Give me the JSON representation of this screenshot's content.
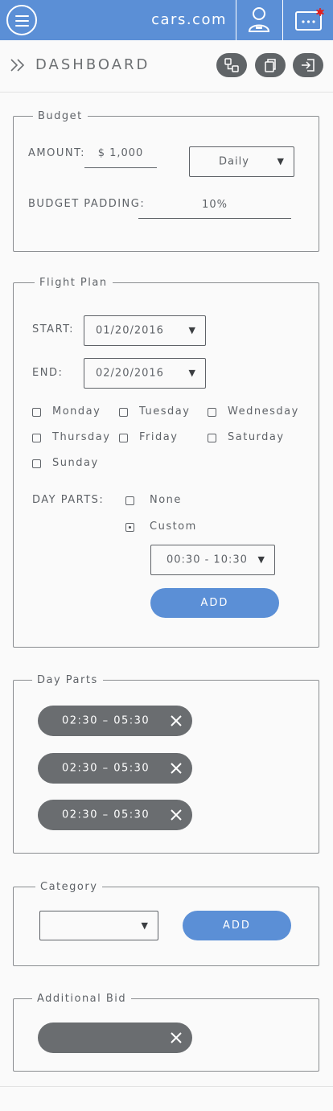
{
  "topbar": {
    "brand": "cars.com",
    "notification_color": "#e02020"
  },
  "header": {
    "title": "DASHBOARD"
  },
  "budget": {
    "legend": "Budget",
    "amount_label": "AMOUNT:",
    "amount_value": "$ 1,000",
    "period": "Daily",
    "padding_label": "BUDGET PADDING:",
    "padding_value": "10%"
  },
  "flight": {
    "legend": "Flight Plan",
    "start_label": "START:",
    "start_value": "01/20/2016",
    "end_label": "END:",
    "end_value": "02/20/2016",
    "days": [
      "Monday",
      "Tuesday",
      "Wednesday",
      "Thursday",
      "Friday",
      "Saturday",
      "Sunday"
    ],
    "day_parts_label": "DAY PARTS:",
    "none_label": "None",
    "custom_label": "Custom",
    "custom_selected": true,
    "time_range": "00:30 - 10:30",
    "add_label": "ADD"
  },
  "day_parts": {
    "legend": "Day Parts",
    "items": [
      "02:30  –  05:30",
      "02:30  –  05:30",
      "02:30  –  05:30"
    ]
  },
  "category": {
    "legend": "Category",
    "selected": "",
    "add_label": "ADD"
  },
  "additional_bid": {
    "legend": "Additional Bid",
    "chip_value": ""
  },
  "colors": {
    "primary": "#5b8fd6",
    "chip": "#6a6d70",
    "text": "#5f6368"
  }
}
